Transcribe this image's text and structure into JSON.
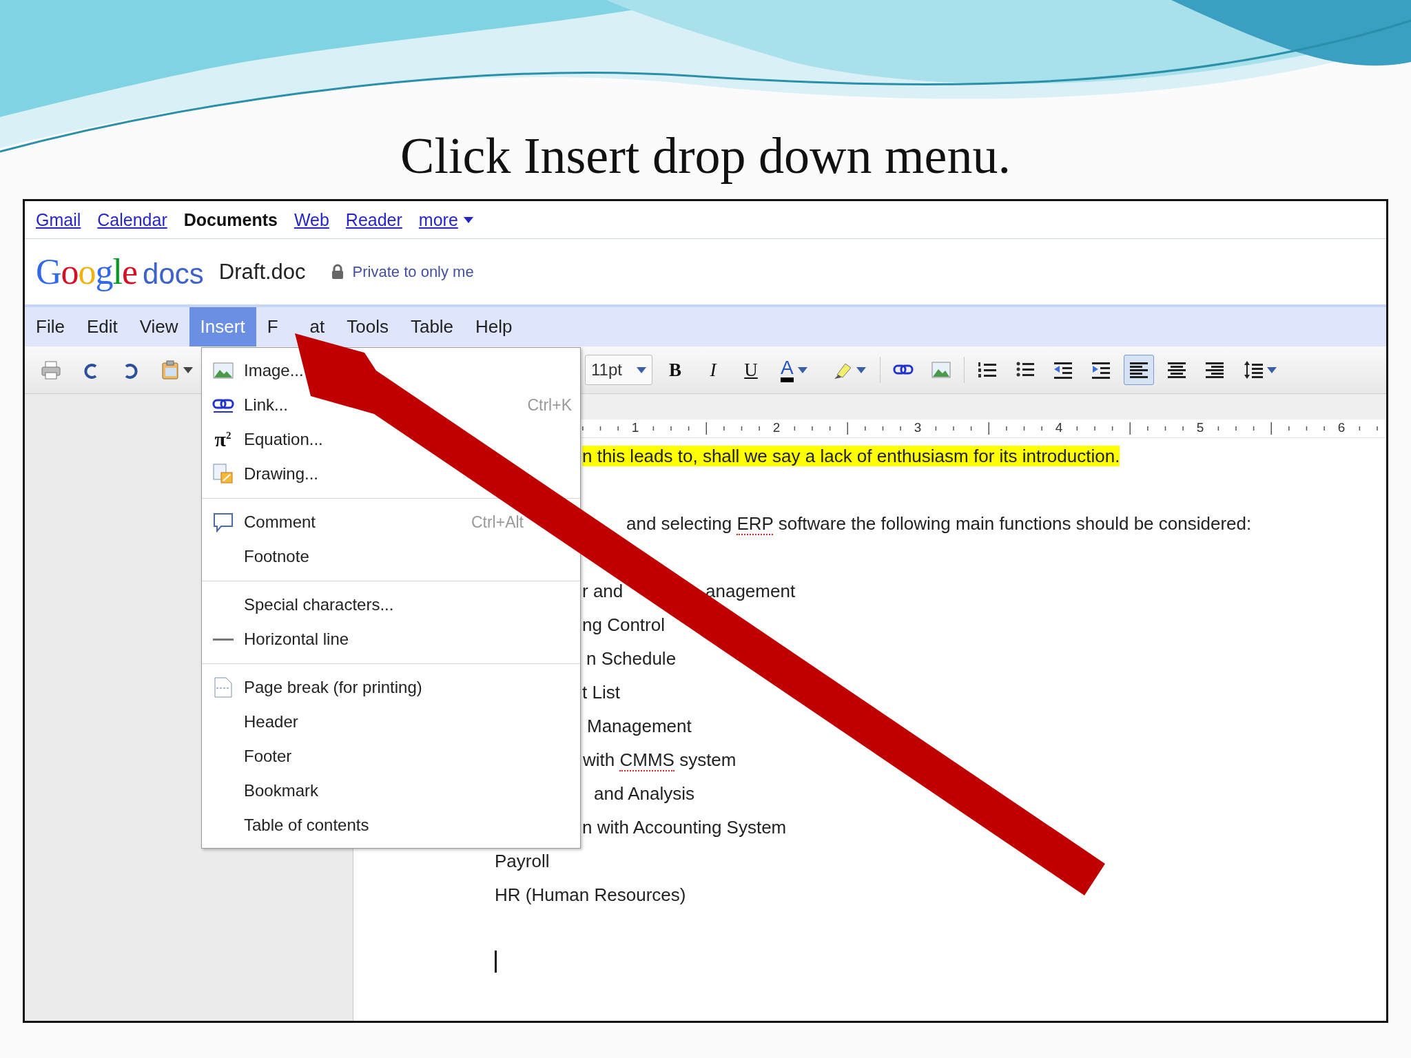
{
  "slide_title": "Click Insert drop down menu.",
  "top_links": [
    {
      "label": "Gmail",
      "current": false,
      "dropdown": false
    },
    {
      "label": "Calendar",
      "current": false,
      "dropdown": false
    },
    {
      "label": "Documents",
      "current": true,
      "dropdown": false
    },
    {
      "label": "Web",
      "current": false,
      "dropdown": false
    },
    {
      "label": "Reader",
      "current": false,
      "dropdown": false
    },
    {
      "label": "more",
      "current": false,
      "dropdown": true
    }
  ],
  "header": {
    "logo_brand": "Google",
    "logo_product": "docs",
    "document_title": "Draft.doc",
    "sharing": "Private to only me"
  },
  "menubar": [
    {
      "label": "File",
      "selected": false
    },
    {
      "label": "Edit",
      "selected": false
    },
    {
      "label": "View",
      "selected": false
    },
    {
      "label": "Insert",
      "selected": true
    },
    {
      "visible_parts": [
        "F",
        "at"
      ],
      "selected": false
    },
    {
      "label": "Tools",
      "selected": false
    },
    {
      "label": "Table",
      "selected": false
    },
    {
      "label": "Help",
      "selected": false
    }
  ],
  "toolbar": {
    "font_size": "11pt",
    "style_buttons": [
      "B",
      "I",
      "U"
    ],
    "text_color": "A",
    "alignment": [
      {
        "selected": true
      },
      {
        "selected": false
      },
      {
        "selected": false
      }
    ]
  },
  "ruler": [
    "1",
    "2",
    "3",
    "4",
    "5",
    "6"
  ],
  "document": {
    "lines": [
      {
        "kind": "text",
        "highlighted": true,
        "fragments": [
          {
            "runs": [
              {
                "text": "n this leads to, shall we say a lack of enthusiasm for its introduction.",
                "misspelled": false
              }
            ]
          }
        ]
      },
      {
        "kind": "blank"
      },
      {
        "kind": "text",
        "highlighted": false,
        "fragments": [
          {
            "runs": [
              {
                "text": "and selecting ",
                "misspelled": false
              },
              {
                "text": "ERP",
                "misspelled": true
              },
              {
                "text": " software the following main functions should be considered:",
                "misspelled": false
              }
            ]
          }
        ]
      },
      {
        "kind": "blank"
      },
      {
        "kind": "text",
        "highlighted": false,
        "fragments": [
          {
            "runs": [
              {
                "text": "r and",
                "misspelled": false
              }
            ]
          },
          {
            "runs": [
              {
                "text": "anagement",
                "misspelled": false
              }
            ]
          }
        ]
      },
      {
        "kind": "text",
        "highlighted": false,
        "fragments": [
          {
            "runs": [
              {
                "text": "ng Control",
                "misspelled": false
              }
            ]
          }
        ]
      },
      {
        "kind": "text",
        "highlighted": false,
        "fragments": [
          {
            "runs": [
              {
                "text": "n Schedule",
                "misspelled": false
              }
            ]
          }
        ]
      },
      {
        "kind": "text",
        "highlighted": false,
        "fragments": [
          {
            "runs": [
              {
                "text": "t List",
                "misspelled": false
              }
            ]
          }
        ]
      },
      {
        "kind": "text",
        "highlighted": false,
        "fragments": [
          {
            "runs": [
              {
                "text": "Management",
                "misspelled": false
              }
            ]
          }
        ]
      },
      {
        "kind": "text",
        "highlighted": false,
        "fragments": [
          {
            "runs": [
              {
                "text": "with ",
                "misspelled": false
              },
              {
                "text": "CMMS",
                "misspelled": true
              },
              {
                "text": " system",
                "misspelled": false
              }
            ]
          }
        ]
      },
      {
        "kind": "text",
        "highlighted": false,
        "fragments": [
          {
            "runs": [
              {
                "text": "and Analysis",
                "misspelled": false
              }
            ]
          }
        ]
      },
      {
        "kind": "text",
        "highlighted": false,
        "fragments": [
          {
            "runs": [
              {
                "text": "n with Accounting System",
                "misspelled": false
              }
            ]
          }
        ]
      },
      {
        "kind": "text",
        "highlighted": false,
        "fragments": [
          {
            "runs": [
              {
                "text": "Payroll",
                "misspelled": false
              }
            ]
          }
        ]
      },
      {
        "kind": "text",
        "highlighted": false,
        "fragments": [
          {
            "runs": [
              {
                "text": "HR (Human Resources)",
                "misspelled": false
              }
            ]
          }
        ]
      },
      {
        "kind": "blank"
      },
      {
        "kind": "cursor"
      }
    ]
  },
  "insert_menu": {
    "items": [
      {
        "kind": "item",
        "label": "Image..."
      },
      {
        "kind": "item",
        "label": "Link...",
        "shortcut": "Ctrl+K"
      },
      {
        "kind": "item",
        "label": "Equation...",
        "icon_text": "π$^{2}$"
      },
      {
        "kind": "item",
        "label": "Drawing..."
      },
      {
        "kind": "separator"
      },
      {
        "kind": "item",
        "label": "Comment",
        "shortcut": "Ctrl+Alt"
      },
      {
        "kind": "item",
        "label": "Footnote"
      },
      {
        "kind": "separator"
      },
      {
        "kind": "item",
        "label": "Special characters..."
      },
      {
        "kind": "item",
        "label": "Horizontal line"
      },
      {
        "kind": "separator"
      },
      {
        "kind": "item",
        "label": "Page break (for printing)"
      },
      {
        "kind": "item",
        "label": "Header"
      },
      {
        "kind": "item",
        "label": "Footer"
      },
      {
        "kind": "item",
        "label": "Bookmark"
      },
      {
        "kind": "item",
        "label": "Table of contents"
      }
    ]
  }
}
